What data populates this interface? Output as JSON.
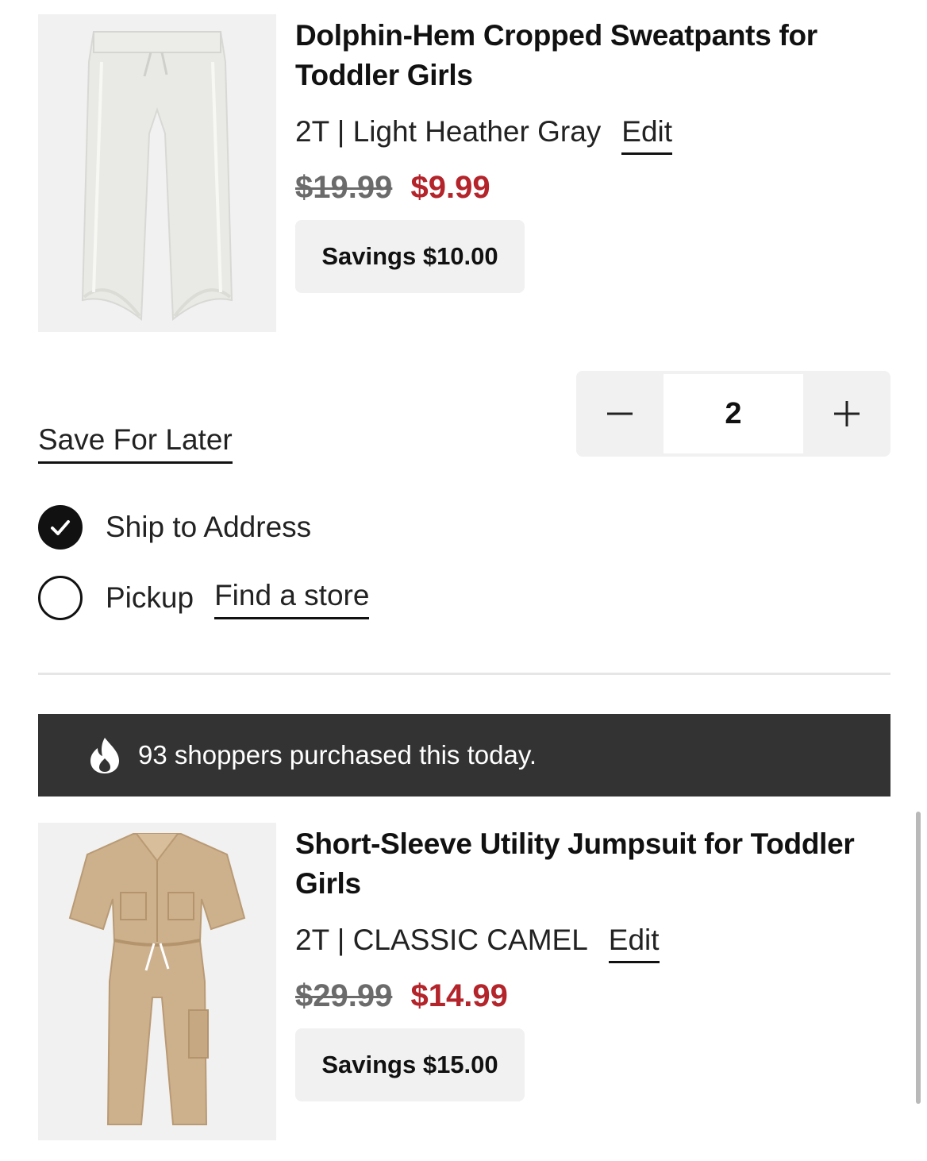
{
  "items": [
    {
      "title": "Dolphin-Hem Cropped Sweatpants for Toddler Girls",
      "variant": "2T | Light Heather Gray",
      "edit_label": "Edit",
      "original_price": "$19.99",
      "sale_price": "$9.99",
      "savings": "Savings $10.00"
    },
    {
      "title": "Short-Sleeve Utility Jumpsuit for Toddler Girls",
      "variant": "2T | CLASSIC CAMEL",
      "edit_label": "Edit",
      "original_price": "$29.99",
      "sale_price": "$14.99",
      "savings": "Savings $15.00"
    }
  ],
  "quantity": {
    "value": "2",
    "decrement_icon": "minus-icon",
    "increment_icon": "plus-icon"
  },
  "save_for_later": "Save For Later",
  "fulfillment": {
    "ship_label": "Ship to Address",
    "ship_selected": true,
    "pickup_label": "Pickup",
    "pickup_selected": false,
    "find_store_label": "Find a store"
  },
  "social_proof": {
    "icon": "flame-icon",
    "text": "93 shoppers purchased this today."
  },
  "colors": {
    "sale_price": "#b3242b",
    "banner_bg": "#333333",
    "chip_bg": "#f1f1f1"
  }
}
